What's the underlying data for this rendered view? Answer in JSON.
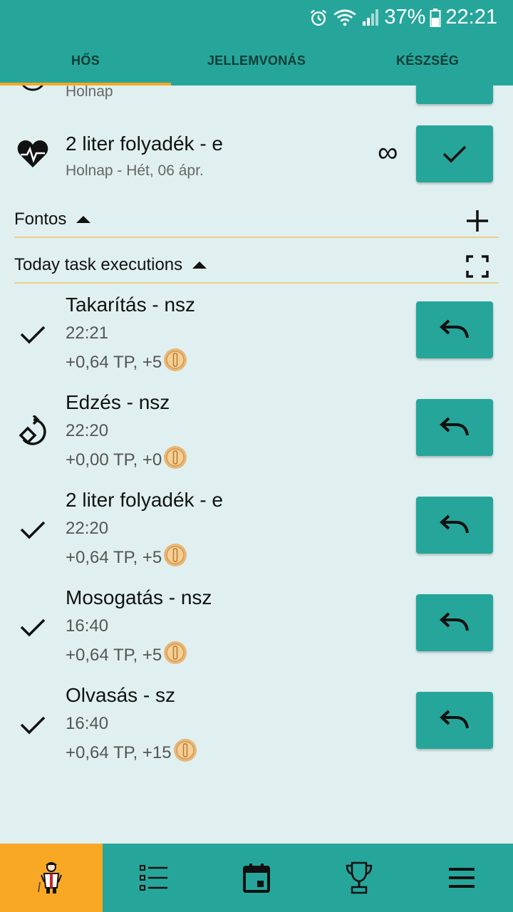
{
  "status_bar": {
    "battery": "37%",
    "time": "22:21"
  },
  "tabs": [
    {
      "label": "HŐS",
      "active": true
    },
    {
      "label": "JELLEMVONÁS",
      "active": false
    },
    {
      "label": "KÉSZSÉG",
      "active": false
    }
  ],
  "habits": [
    {
      "subtitle": "Holnap",
      "partial": true
    },
    {
      "title": "2 liter folyadék - e",
      "subtitle": "Holnap - Hét, 06 ápr.",
      "repeat_symbol": "∞",
      "icon": "heart-pulse-icon"
    }
  ],
  "sections": {
    "important": {
      "title": "Fontos"
    },
    "executions": {
      "title": "Today task executions"
    }
  },
  "executions": [
    {
      "title": "Takarítás - nsz",
      "time": "22:21",
      "reward": "+0,64 TP, +5",
      "status_icon": "check-icon"
    },
    {
      "title": "Edzés - nsz",
      "time": "22:20",
      "reward": "+0,00 TP, +0",
      "status_icon": "rotate-icon"
    },
    {
      "title": "2 liter folyadék - e",
      "time": "22:20",
      "reward": "+0,64 TP, +5",
      "status_icon": "check-icon"
    },
    {
      "title": "Mosogatás - nsz",
      "time": "16:40",
      "reward": "+0,64 TP, +5",
      "status_icon": "check-icon"
    },
    {
      "title": "Olvasás - sz",
      "time": "16:40",
      "reward": "+0,64 TP, +15",
      "status_icon": "check-icon"
    }
  ],
  "bottom_nav": [
    {
      "name": "hero-icon",
      "active": true
    },
    {
      "name": "task-list-icon",
      "active": false
    },
    {
      "name": "calendar-icon",
      "active": false
    },
    {
      "name": "trophy-icon",
      "active": false
    },
    {
      "name": "menu-icon",
      "active": false
    }
  ],
  "colors": {
    "primary": "#26a69a",
    "accent": "#f9a825",
    "background": "#e0f0f0",
    "divider": "#e9cf8a"
  }
}
